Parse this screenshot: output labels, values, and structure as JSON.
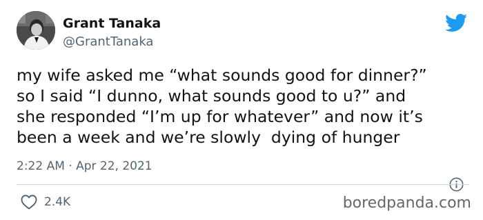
{
  "author": {
    "display_name": "Grant Tanaka",
    "handle": "@GrantTanaka"
  },
  "tweet": {
    "text": "my wife asked me “what sounds good for dinner?”\nso I said “I dunno, what sounds good to u?” and\nshe responded “I’m up for whatever” and now it’s\nbeen a week and we’re slowly  dying of hunger",
    "timestamp": "2:22 AM · Apr 22, 2021"
  },
  "engagement": {
    "like_count": "2.4K"
  },
  "watermark": "boredpanda.com",
  "icons": {
    "brand": "twitter-bird-icon",
    "info": "info-icon",
    "like": "heart-icon"
  },
  "colors": {
    "text_primary": "#0f1419",
    "text_secondary": "#536471",
    "twitter_blue": "#1d9bf0",
    "divider": "#cfd9de",
    "watermark": "#666666"
  }
}
